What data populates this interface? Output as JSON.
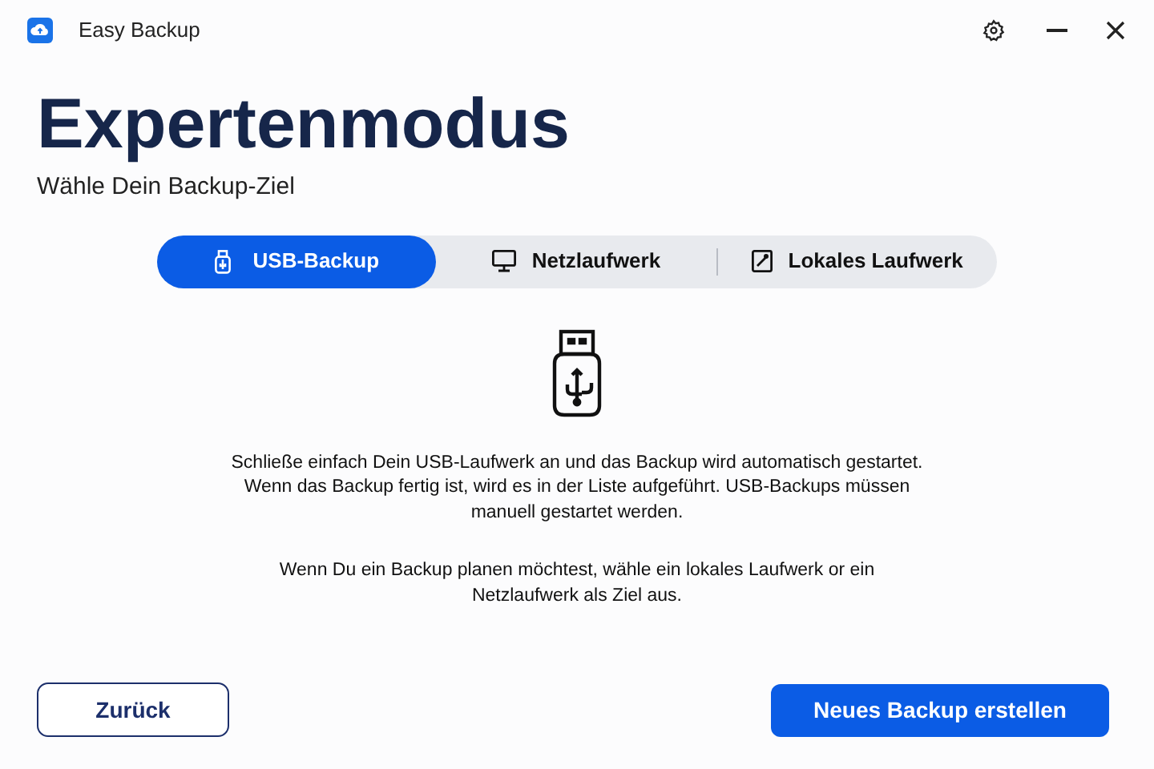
{
  "window": {
    "title": "Easy Backup"
  },
  "heading": "Expertenmodus",
  "subheading": "Wähle Dein Backup-Ziel",
  "tabs": [
    {
      "label": "USB-Backup",
      "kind": "usb",
      "selected": true
    },
    {
      "label": "Netzlaufwerk",
      "kind": "network",
      "selected": false
    },
    {
      "label": "Lokales Laufwerk",
      "kind": "local",
      "selected": false
    }
  ],
  "description": [
    [
      "Schließe einfach Dein USB-Laufwerk an und das Backup wird automatisch gestartet.",
      "Wenn das Backup fertig ist, wird es in der Liste aufgeführt. USB-Backups müssen manuell gestartet werden."
    ],
    [
      "Wenn Du ein Backup planen möchtest, wähle ein lokales Laufwerk or ein Netzlaufwerk als Ziel aus."
    ]
  ],
  "buttons": {
    "back": "Zurück",
    "create": "Neues Backup erstellen"
  }
}
